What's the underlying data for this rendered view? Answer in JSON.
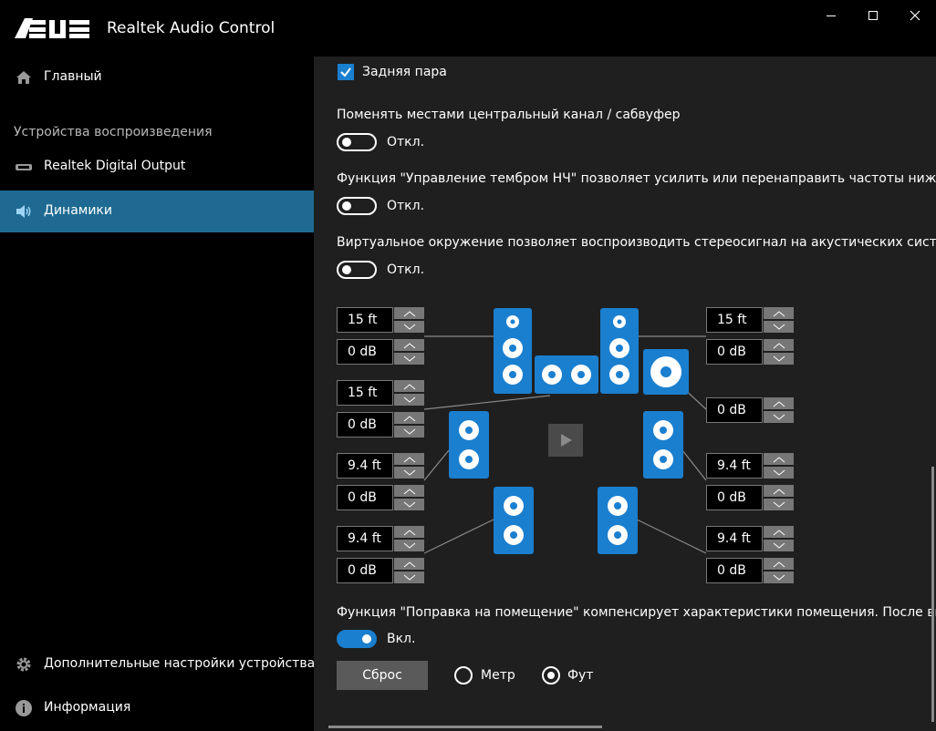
{
  "window": {
    "title": "Realtek Audio Control",
    "brand": "ASUS"
  },
  "sidebar": {
    "home": "Главный",
    "section": "Устройства воспроизведения",
    "items": [
      {
        "label": "Realtek Digital Output",
        "icon": "digital-output-icon"
      },
      {
        "label": "Динамики",
        "icon": "speaker-icon",
        "active": true
      }
    ],
    "advanced": "Дополнительные настройки устройства",
    "info": "Информация"
  },
  "main": {
    "rear_pair": {
      "label": "Задняя пара",
      "checked": true
    },
    "swap_center": {
      "label": "Поменять местами центральный канал / сабвуфер",
      "state": "Откл."
    },
    "bass": {
      "label": "Функция \"Управление тембром НЧ\" позволяет усилить или перенаправить частоты ниже точки",
      "state": "Откл."
    },
    "virtual": {
      "label": "Виртуальное окружение позволяет воспроизводить стереосигнал на акустических системах об",
      "state": "Откл."
    },
    "room": {
      "label": "Функция \"Поправка на помещение\" компенсирует характеристики помещения. После включен",
      "state": "Вкл."
    },
    "left_spins": [
      "15 ft",
      "0 dB",
      "15 ft",
      "0 dB",
      "9.4 ft",
      "0 dB",
      "9.4 ft",
      "0 dB"
    ],
    "right_spins": [
      "15 ft",
      "0 dB",
      "0 dB",
      "9.4 ft",
      "0 dB",
      "9.4 ft",
      "0 dB"
    ],
    "reset": "Сброс",
    "units": [
      {
        "label": "Метр",
        "selected": false
      },
      {
        "label": "Фут",
        "selected": true
      }
    ]
  },
  "colors": {
    "accent": "#1a7fcf",
    "active_nav": "#1e6a92",
    "panel": "#1f1f1f"
  }
}
